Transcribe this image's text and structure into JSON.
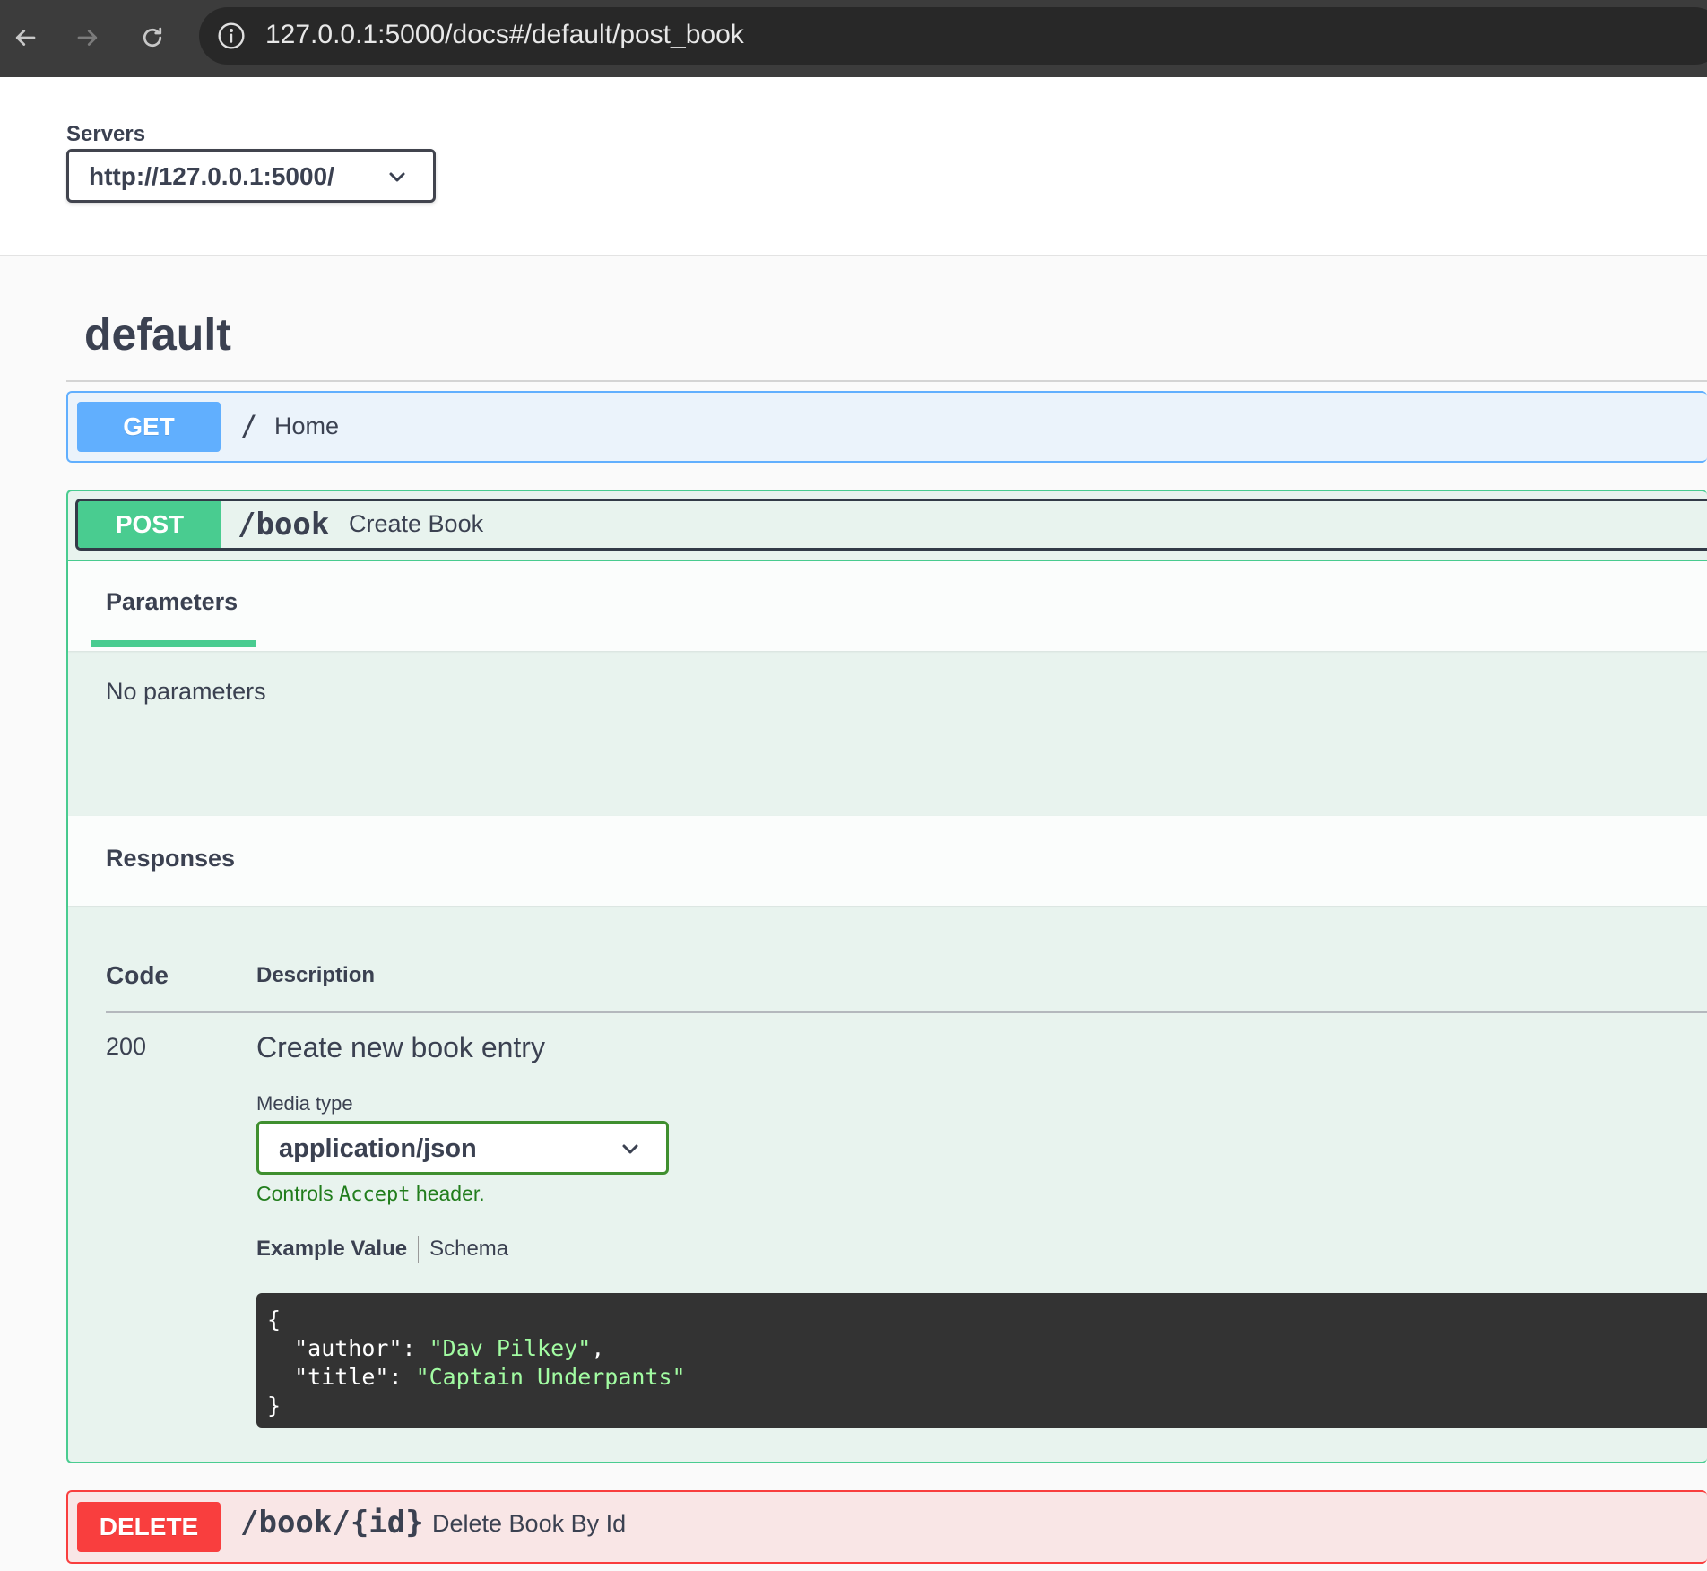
{
  "browser": {
    "url": "127.0.0.1:5000/docs#/default/post_book"
  },
  "servers": {
    "label": "Servers",
    "selected": "http://127.0.0.1:5000/"
  },
  "tag": {
    "title": "default"
  },
  "operations": {
    "get": {
      "method": "GET",
      "path": "/",
      "summary": "Home"
    },
    "post": {
      "method": "POST",
      "path": "/book",
      "summary": "Create Book",
      "parameters_tab": "Parameters",
      "no_parameters": "No parameters",
      "responses_label": "Responses",
      "col_code": "Code",
      "col_description": "Description",
      "response": {
        "code": "200",
        "description": "Create new book entry",
        "media_type_label": "Media type",
        "media_type": "application/json",
        "hint_prefix": "Controls ",
        "hint_code": "Accept",
        "hint_suffix": " header.",
        "example_value_tab": "Example Value",
        "schema_tab": "Schema",
        "example": {
          "open": "{",
          "author_key": "  \"author\": ",
          "author_value": "\"Dav Pilkey\"",
          "author_comma": ",",
          "title_key": "  \"title\": ",
          "title_value": "\"Captain Underpants\"",
          "close": "}"
        }
      }
    },
    "delete": {
      "method": "DELETE",
      "path": "/book/{id}",
      "summary": "Delete Book By Id"
    }
  },
  "colors": {
    "get": "#61affe",
    "post": "#49cc90",
    "delete": "#f93e3e",
    "code_bg": "#333333",
    "code_string": "#a2fca2",
    "hint": "#217d1c"
  },
  "icons": {
    "back": "arrow-left-icon",
    "forward": "arrow-right-icon",
    "reload": "reload-icon",
    "info": "info-icon",
    "dropdown": "chevron-down-icon"
  }
}
